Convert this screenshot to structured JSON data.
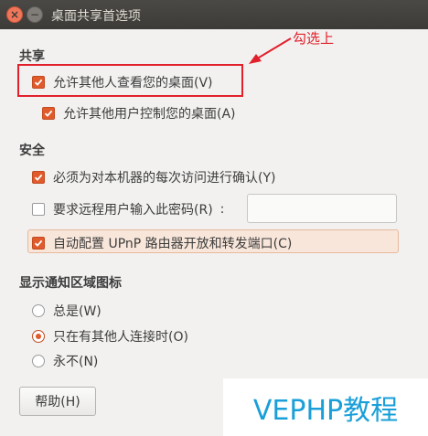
{
  "window": {
    "title": "桌面共享首选项"
  },
  "annotation": {
    "text": "勾选上",
    "color": "#e2202b"
  },
  "sharing": {
    "heading": "共享",
    "allow_view": {
      "label": "允许其他人查看您的桌面(V)",
      "checked": true
    },
    "allow_control": {
      "label": "允许其他用户控制您的桌面(A)",
      "checked": true
    }
  },
  "security": {
    "heading": "安全",
    "confirm_access": {
      "label": "必须为对本机器的每次访问进行确认(Y)",
      "checked": true
    },
    "require_password": {
      "label": "要求远程用户输入此密码(R)",
      "checked": false
    },
    "password_colon": ":",
    "upnp": {
      "label": "自动配置 UPnP 路由器开放和转发端口(C)",
      "checked": true
    }
  },
  "notification": {
    "heading": "显示通知区域图标",
    "options": [
      {
        "label": "总是(W)",
        "selected": false
      },
      {
        "label": "只在有其他人连接时(O)",
        "selected": true
      },
      {
        "label": "永不(N)",
        "selected": false
      }
    ]
  },
  "buttons": {
    "help": "帮助(H)"
  },
  "watermark": {
    "text": "VEPHP教程"
  },
  "colors": {
    "accent": "#e05a2b",
    "titlebar": "#3c3b37",
    "watermark": "#1a9fd9"
  }
}
